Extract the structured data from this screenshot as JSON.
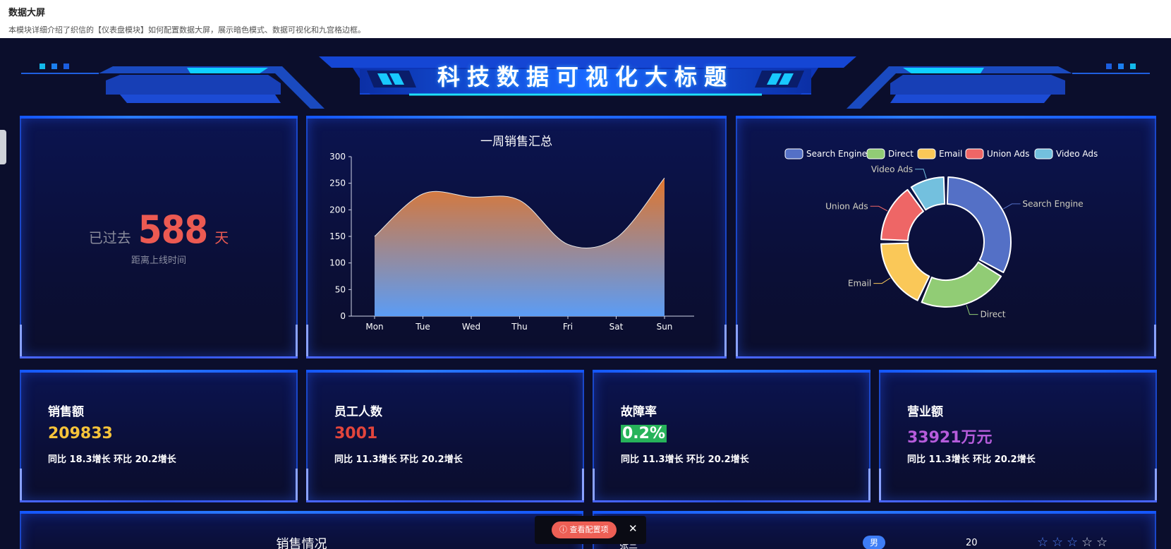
{
  "page": {
    "title": "数据大屏",
    "description": "本模块详细介绍了织信的【仪表盘模块】如何配置数据大屏，展示暗色模式、数据可视化和九宫格边框。"
  },
  "banner": {
    "title": "科技数据可视化大标题"
  },
  "countdown": {
    "prefix": "已过去",
    "value": "588",
    "unit": "天",
    "subtitle": "距离上线时间"
  },
  "chart_area": {
    "chart_data": {
      "type": "area",
      "title": "一周销售汇总",
      "categories": [
        "Mon",
        "Tue",
        "Wed",
        "Thu",
        "Fri",
        "Sat",
        "Sun"
      ],
      "series": [
        {
          "values": [
            150,
            230,
            224,
            218,
            135,
            147,
            260
          ]
        }
      ],
      "ylim": [
        0,
        300
      ],
      "yticks": [
        0,
        50,
        100,
        150,
        200,
        250,
        300
      ],
      "smooth": true,
      "colors": {
        "top": "#e0752d",
        "bottom": "#5b9cf5"
      }
    }
  },
  "chart_donut": {
    "chart_data": {
      "type": "pie",
      "labels": [
        "Search Engine",
        "Direct",
        "Email",
        "Union Ads",
        "Video Ads"
      ],
      "values": [
        1048,
        735,
        580,
        484,
        300
      ],
      "colors": [
        "#5470c6",
        "#91cc75",
        "#fac858",
        "#ee6666",
        "#73c0de"
      ],
      "legend": "top"
    }
  },
  "stats": [
    {
      "label": "销售额",
      "value": "209833",
      "color": "#f6c33a",
      "trend": "同比 18.3增长 环比 20.2增长"
    },
    {
      "label": "员工人数",
      "value": "3001",
      "color": "#e2453c",
      "trend": "同比 11.3增长 环比 20.2增长"
    },
    {
      "label": "故障率",
      "value": "0.2%",
      "color": "#ffffff",
      "bg": "#27b35a",
      "trend": "同比 11.3增长 环比 20.2增长"
    },
    {
      "label": "营业额",
      "value": "33921万元",
      "color": "#b65cdb",
      "trend": "同比 11.3增长 环比 20.2增长"
    }
  ],
  "sales_panel": {
    "title": "销售情况"
  },
  "table": {
    "rows": [
      {
        "name": "张三",
        "gender": "男",
        "age": "20",
        "stars": 3
      }
    ]
  },
  "floating_bar": {
    "config_label": "查看配置项",
    "close_label": "✕"
  }
}
